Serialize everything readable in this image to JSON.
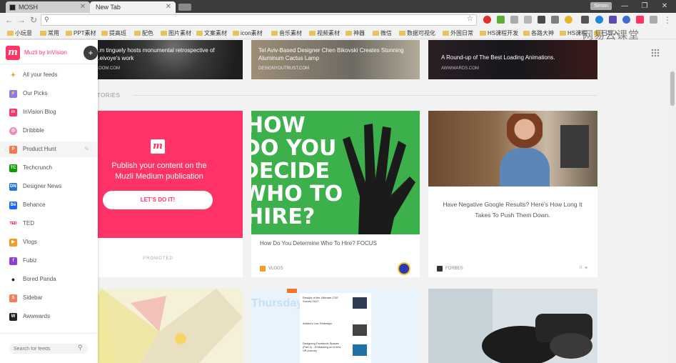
{
  "browser": {
    "tabs": [
      {
        "title": "MOSH"
      },
      {
        "title": "New Tab"
      }
    ],
    "window_user_badge": "Simon"
  },
  "bookmarks": [
    "小玩意",
    "常用",
    "PPT素材",
    "提高班",
    "配色",
    "图片素材",
    "文案素材",
    "icon素材",
    "音乐素材",
    "视频素材",
    "神器",
    "微信",
    "数据可视化",
    "外国日常",
    "HS课程开发",
    "各路大神",
    "HS课程",
    "已导入",
    "网易云课堂"
  ],
  "watermark": "网易云课堂",
  "sidebar": {
    "brand": "Muzli by InVision",
    "add_label": "+",
    "items": [
      {
        "label": "All your feeds",
        "icon": "sparkle-icon",
        "color": "#ffffff"
      },
      {
        "label": "Our Picks",
        "icon": "bolt-icon",
        "color": "#8a7cf0"
      },
      {
        "label": "InVision Blog",
        "icon": "invision-icon",
        "color": "#ff3366"
      },
      {
        "label": "Dribbble",
        "icon": "dribbble-icon",
        "color": "#ea8fb8"
      },
      {
        "label": "Product Hunt",
        "icon": "producthunt-icon",
        "color": "#f1794d"
      },
      {
        "label": "Techcrunch",
        "icon": "techcrunch-icon",
        "color": "#0a9e01"
      },
      {
        "label": "Designer News",
        "icon": "designernews-icon",
        "color": "#2d72d9"
      },
      {
        "label": "Behance",
        "icon": "behance-icon",
        "color": "#1769ff"
      },
      {
        "label": "TED",
        "icon": "ted-icon",
        "color": "#eb0028"
      },
      {
        "label": "Vlogs",
        "icon": "play-icon",
        "color": "#f39c27"
      },
      {
        "label": "Fubiz",
        "icon": "fubiz-icon",
        "color": "#8e3fd8"
      },
      {
        "label": "Bored Panda",
        "icon": "panda-icon",
        "color": "#ffffff"
      },
      {
        "label": "Sidebar",
        "icon": "sidebar-icon",
        "color": "#f47c56"
      },
      {
        "label": "Awwwards",
        "icon": "awwwards-icon",
        "color": "#222222"
      }
    ],
    "search_placeholder": "Search for feeds"
  },
  "section_label": "STORIES",
  "top_cards": [
    {
      "title": "...m tinguely hosts monumental retrospective of ...eivoye's work",
      "source": "...OOM.COM"
    },
    {
      "title": "Tel Aviv-Based Designer Chen Bikovski Creates Stunning Aluminum Cactus Lamp",
      "source": "DESIGNYOUTRUST.COM"
    },
    {
      "title": "A Round-up of The Best Loading Animations.",
      "source": "AWWWARDS.COM"
    }
  ],
  "promo_card": {
    "headline": "Publish your content on the Muzli Medium publication",
    "cta": "LET'S DO IT!",
    "footer": "PROMOTED"
  },
  "card_hire": {
    "image_text": [
      "HOW",
      "DO YOU",
      "DECIDE",
      "WHO TO",
      "HIRE?"
    ],
    "title": "How Do You Determine Who To Hire? FOCUS",
    "source": "VLOGS"
  },
  "card_google": {
    "title": "Have Negative Google Results? Here's How Long It Takes To Push Them Down.",
    "source": "FORBES",
    "likes": "0"
  },
  "card_thursday": {
    "header": "Thursday",
    "items": [
      "Results of the Ultimate CSS Survey 2017",
      "Adobe's Live Redesign",
      "Designing Facebook Spaces (Part 1) - Embarking on a new VR journey"
    ]
  },
  "colors": {
    "brand_pink": "#ff3366",
    "hire_green": "#3cb04a"
  }
}
